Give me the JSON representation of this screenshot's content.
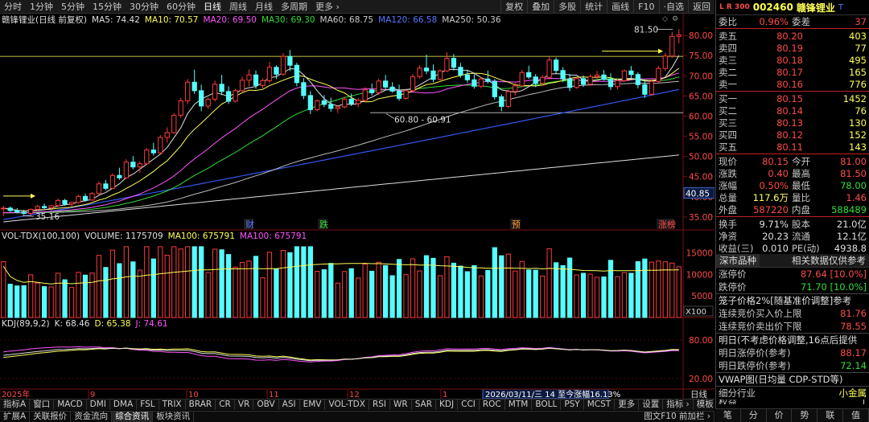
{
  "toolbar": {
    "periods": [
      "分时",
      "1分钟",
      "5分钟",
      "15分钟",
      "30分钟",
      "60分钟",
      "日线",
      "周线",
      "月线",
      "多周期",
      "更多 ›"
    ],
    "active": "日线",
    "right": [
      "复权",
      "叠加",
      "多股",
      "统计",
      "画线",
      "F10",
      "·自选",
      "返回"
    ]
  },
  "legend": {
    "title": "赣锋锂业(日线 前复权)",
    "ma": [
      {
        "label": "MA5: 74.42",
        "color": "#e0e0e0"
      },
      {
        "label": "MA10: 70.57",
        "color": "#ffff55"
      },
      {
        "label": "MA20: 69.50",
        "color": "#ff55ff"
      },
      {
        "label": "MA30: 69.30",
        "color": "#33dd33"
      },
      {
        "label": "MA60: 68.75",
        "color": "#cccccc"
      },
      {
        "label": "MA120: 66.58",
        "color": "#5577ff"
      },
      {
        "label": "MA250: 50.36",
        "color": "#cccccc"
      }
    ]
  },
  "vol_legend": {
    "title": "VOL-TDX(100,100)",
    "items": [
      {
        "label": "VOLUME: 1175709",
        "color": "#e0e0e0"
      },
      {
        "label": "MA100: 675791",
        "color": "#ffff55"
      },
      {
        "label": "MA100: 675791",
        "color": "#ff55ff"
      }
    ]
  },
  "kdj_legend": {
    "title": "KDJ(89,9,2)",
    "items": [
      {
        "label": "K: 68.46",
        "color": "#e0e0e0"
      },
      {
        "label": "D: 65.38",
        "color": "#ffff55"
      },
      {
        "label": "J: 74.61",
        "color": "#ff55ff"
      }
    ]
  },
  "price_axis": [
    "80.00",
    "75.00",
    "70.00",
    "65.00",
    "60.00",
    "55.00",
    "50.00",
    "45.00",
    "40.00",
    "35.00"
  ],
  "vol_axis": [
    "15000",
    "10000",
    "5000"
  ],
  "vol_unit": "X100",
  "kdj_axis": [
    "80.00",
    "20.00"
  ],
  "current_price_tag": "40.85",
  "annotations": {
    "high": "81.50",
    "range": "60.80 - 60.91",
    "low": "35.16"
  },
  "event_labels": [
    {
      "text": "财",
      "color": "#5577ff"
    },
    {
      "text": "跌",
      "color": "#33dd33"
    },
    {
      "text": "预",
      "color": "#ff9933"
    },
    {
      "text": "涨榜",
      "color": "#ff4a4a"
    }
  ],
  "time_axis": [
    "2025年",
    "9",
    "10",
    "11",
    "12",
    "1",
    "2026/03/11/三 14 至今涨幅16.13%"
  ],
  "time_axis_right": "日线",
  "indicator_tabs": [
    "指标A",
    "窗口",
    "MACD",
    "DMI",
    "DMA",
    "FSL",
    "TRIX",
    "BRAR",
    "CR",
    "VR",
    "OBV",
    "ASI",
    "EMV",
    "VOL-TDX",
    "RSI",
    "WR",
    "SAR",
    "KDJ",
    "CCI",
    "ROC",
    "MTM",
    "BOLL",
    "PSY",
    "MCST",
    "更多",
    "设置"
  ],
  "indicator_tabs_right": [
    "指标 ›",
    "模板",
    "板"
  ],
  "status_tabs": [
    "扩展A",
    "关联报价",
    "资金流向",
    "综合资讯",
    "板块资讯"
  ],
  "status_active": "综合资讯",
  "status_right": "图文F10 前加栏 ›",
  "quote": {
    "badge": "L R 300",
    "code": "002460",
    "name": "赣锋锂业",
    "suffix": "T",
    "webi": {
      "k1": "委比",
      "v1": "0.96%",
      "k2": "委差",
      "v2": "37"
    },
    "asks": [
      {
        "k": "卖五",
        "p": "80.20",
        "q": "403"
      },
      {
        "k": "卖四",
        "p": "80.19",
        "q": "77"
      },
      {
        "k": "卖三",
        "p": "80.18",
        "q": "495"
      },
      {
        "k": "卖二",
        "p": "80.17",
        "q": "165"
      },
      {
        "k": "卖一",
        "p": "80.16",
        "q": "776"
      }
    ],
    "bids": [
      {
        "k": "买一",
        "p": "80.15",
        "q": "1452"
      },
      {
        "k": "买二",
        "p": "80.14",
        "q": "76"
      },
      {
        "k": "买三",
        "p": "80.13",
        "q": "130"
      },
      {
        "k": "买四",
        "p": "80.12",
        "q": "152"
      },
      {
        "k": "买五",
        "p": "80.11",
        "q": "143"
      }
    ],
    "stats1": [
      {
        "k1": "现价",
        "v1": "80.15",
        "c1": "#ff4a4a",
        "k2": "今开",
        "v2": "81.00",
        "c2": "#ff4a4a"
      },
      {
        "k1": "涨跌",
        "v1": "0.40",
        "c1": "#ff4a4a",
        "k2": "最高",
        "v2": "81.50",
        "c2": "#ff4a4a"
      },
      {
        "k1": "涨幅",
        "v1": "0.50%",
        "c1": "#ff4a4a",
        "k2": "最低",
        "v2": "78.00",
        "c2": "#33dd33"
      },
      {
        "k1": "总量",
        "v1": "117.6万",
        "c1": "#ffff55",
        "k2": "量比",
        "v2": "1.46",
        "c2": "#ff4a4a"
      },
      {
        "k1": "外盘",
        "v1": "587220",
        "c1": "#ff4a4a",
        "k2": "内盘",
        "v2": "588489",
        "c2": "#33dd33"
      }
    ],
    "stats2": [
      {
        "k1": "换手",
        "v1": "9.71%",
        "c1": "#e0e0e0",
        "k2": "股本",
        "v2": "21.0亿",
        "c2": "#e0e0e0"
      },
      {
        "k1": "净资",
        "v1": "20.23",
        "c1": "#e0e0e0",
        "k2": "流通",
        "v2": "12.1亿",
        "c2": "#e0e0e0"
      },
      {
        "k1": "收益(三)",
        "v1": "0.010",
        "c1": "#e0e0e0",
        "k2": "PE(动)",
        "v2": "4938.8",
        "c2": "#e0e0e0"
      }
    ],
    "tab_row": [
      "深市品种",
      "相关数据仅供参考"
    ],
    "limits": [
      {
        "k": "涨停价",
        "v": "87.64 [10.0%]",
        "c": "#ff4a4a"
      },
      {
        "k": "跌停价",
        "v": "71.70 [10.0%]",
        "c": "#33dd33"
      }
    ],
    "cage_title": "笼子价格2%[随基准价调整]参考",
    "cage": [
      {
        "k": "连续竞价买入价上限",
        "v": "81.76",
        "c": "#ff4a4a"
      },
      {
        "k": "连续竞价卖出价下限",
        "v": "78.55",
        "c": "#ff4a4a"
      }
    ],
    "tomorrow_title": "明日(不考虑价格调整,16点后提供",
    "tomorrow": [
      {
        "k": "明日涨停价(参考)",
        "v": "88.17",
        "c": "#ff4a4a"
      },
      {
        "k": "明日跌停价(参考)",
        "v": "72.14",
        "c": "#33dd33"
      }
    ],
    "vwap": "VWAP图(日均量 CDP-STD等)",
    "industry": {
      "k": "细分行业",
      "v": "小金属"
    },
    "partial": {
      "k": "权益",
      "v": "1"
    }
  },
  "right_bottom": [
    "笔",
    "分",
    "价",
    "势",
    "联",
    "值"
  ],
  "chart_data": {
    "type": "line",
    "title": "赣锋锂业(日线 前复权)",
    "price": {
      "ylim": [
        32,
        83
      ],
      "ma_last": {
        "MA5": 74.42,
        "MA10": 70.57,
        "MA20": 69.5,
        "MA30": 69.3,
        "MA60": 68.75,
        "MA120": 66.58,
        "MA250": 50.36
      },
      "candles": [
        [
          37,
          37.8,
          35.2,
          37.2
        ],
        [
          37.2,
          37.6,
          36.2,
          36.6
        ],
        [
          36.6,
          37.2,
          35.9,
          36.2
        ],
        [
          36.2,
          36.8,
          35.5,
          35.9
        ],
        [
          35.9,
          37.1,
          35.2,
          36.9
        ],
        [
          36.9,
          38,
          36.5,
          37.6
        ],
        [
          37.6,
          38.3,
          37,
          37.3
        ],
        [
          37.3,
          37.9,
          36.6,
          37.8
        ],
        [
          37.8,
          39.6,
          37.5,
          39.1
        ],
        [
          39.1,
          39.5,
          37.8,
          38.2
        ],
        [
          38.2,
          38.8,
          37.5,
          38.6
        ],
        [
          38.6,
          40.5,
          38.3,
          40.1
        ],
        [
          40.1,
          40.8,
          38.8,
          39.2
        ],
        [
          39.2,
          41.2,
          39,
          40.8
        ],
        [
          40.8,
          43.8,
          40.4,
          43.2
        ],
        [
          43.2,
          44.2,
          41.6,
          42.1
        ],
        [
          42.1,
          45.8,
          41.9,
          45.3
        ],
        [
          45.3,
          47.2,
          44.2,
          44.7
        ],
        [
          44.7,
          49.3,
          44.4,
          48.6
        ],
        [
          48.6,
          50.1,
          46.8,
          47.4
        ],
        [
          47.4,
          48.8,
          46,
          48.2
        ],
        [
          48.2,
          52.1,
          47.9,
          51.6
        ],
        [
          51.6,
          53.4,
          50.2,
          50.9
        ],
        [
          50.9,
          55.3,
          50.6,
          54.7
        ],
        [
          54.7,
          57.2,
          53.4,
          55.9
        ],
        [
          55.9,
          60.8,
          55.6,
          60.2
        ],
        [
          60.2,
          64.5,
          59.6,
          63.8
        ],
        [
          63.8,
          69.2,
          62.9,
          68.4
        ],
        [
          68.4,
          71.5,
          65.5,
          66.3
        ],
        [
          66.3,
          67.8,
          61.2,
          62.5
        ],
        [
          62.5,
          64.6,
          61.8,
          64.2
        ],
        [
          64.2,
          68.8,
          63.6,
          67.9
        ],
        [
          67.9,
          70.2,
          65.2,
          66.1
        ],
        [
          66.1,
          67.4,
          63,
          63.7
        ],
        [
          63.7,
          66.8,
          63.4,
          66.3
        ],
        [
          66.3,
          69.8,
          65.8,
          68.9
        ],
        [
          68.9,
          71.6,
          67.4,
          70.2
        ],
        [
          70.2,
          71.3,
          66.8,
          67.6
        ],
        [
          67.6,
          69.4,
          66.9,
          68.8
        ],
        [
          68.8,
          73.4,
          68.2,
          72.1
        ],
        [
          72.1,
          72.6,
          69.2,
          70.4
        ],
        [
          70.4,
          75.6,
          70,
          74.8
        ],
        [
          74.8,
          76.4,
          71.2,
          72.6
        ],
        [
          72.6,
          73.2,
          67.4,
          68.3
        ],
        [
          68.3,
          69.4,
          64.2,
          65.1
        ],
        [
          65.1,
          66.2,
          60.5,
          61.6
        ],
        [
          61.6,
          64.1,
          61.2,
          63.8
        ],
        [
          63.8,
          65.2,
          62.2,
          62.9
        ],
        [
          62.9,
          64.6,
          61.1,
          61.9
        ],
        [
          61.9,
          62.6,
          60.8,
          62.3
        ],
        [
          62.3,
          64.8,
          61.9,
          64.2
        ],
        [
          64.2,
          65.6,
          62.5,
          63.1
        ],
        [
          63.1,
          64.5,
          62.2,
          63.9
        ],
        [
          63.9,
          67.2,
          63.5,
          66.5
        ],
        [
          66.5,
          68.1,
          65.1,
          65.8
        ],
        [
          65.8,
          69.3,
          65.3,
          68.7
        ],
        [
          68.7,
          70.2,
          66.6,
          67.2
        ],
        [
          67.2,
          68.4,
          65.8,
          66.2
        ],
        [
          66.2,
          67.8,
          63.8,
          64.4
        ],
        [
          64.4,
          66.8,
          64.1,
          66.3
        ],
        [
          66.3,
          70.4,
          66,
          69.8
        ],
        [
          69.8,
          72.6,
          69.3,
          71.9
        ],
        [
          71.9,
          75.2,
          70.4,
          71.2
        ],
        [
          71.2,
          72.8,
          68.4,
          69.1
        ],
        [
          69.1,
          71.6,
          68.8,
          71.2
        ],
        [
          71.2,
          75.8,
          70.9,
          74.3
        ],
        [
          74.3,
          75.4,
          71.3,
          72.1
        ],
        [
          72.1,
          73.2,
          69.5,
          70.2
        ],
        [
          70.2,
          71.4,
          68.3,
          69
        ],
        [
          69,
          70.4,
          66.8,
          67.4
        ],
        [
          67.4,
          69.6,
          66.9,
          69.2
        ],
        [
          69.2,
          71.3,
          68.1,
          68.6
        ],
        [
          68.6,
          69.2,
          64.1,
          64.8
        ],
        [
          64.8,
          65.4,
          61.2,
          62.4
        ],
        [
          62.4,
          66.6,
          62,
          66.1
        ],
        [
          66.1,
          68.2,
          65.1,
          67.5
        ],
        [
          67.5,
          71.4,
          67.2,
          70.8
        ],
        [
          70.8,
          72.5,
          69.2,
          69.7
        ],
        [
          69.7,
          70.4,
          67.2,
          68.1
        ],
        [
          68.1,
          70.2,
          67.5,
          69.6
        ],
        [
          69.6,
          74.8,
          69.1,
          73.9
        ],
        [
          73.9,
          74.5,
          70.4,
          71.3
        ],
        [
          71.3,
          72.1,
          68.4,
          69.2
        ],
        [
          69.2,
          70.5,
          66.2,
          67.1
        ],
        [
          67.1,
          69.6,
          66.8,
          69.3
        ],
        [
          69.3,
          70.1,
          67.2,
          67.9
        ],
        [
          67.9,
          70.4,
          67.5,
          69.8
        ],
        [
          69.8,
          71.2,
          68.6,
          70.2
        ],
        [
          70.2,
          71.4,
          68.8,
          69.1
        ],
        [
          69.1,
          70.6,
          66.5,
          67.3
        ],
        [
          67.3,
          69.2,
          66.6,
          68.8
        ],
        [
          68.8,
          71.6,
          68.5,
          71.2
        ],
        [
          71.2,
          72.4,
          69.4,
          70.3
        ],
        [
          70.3,
          70.9,
          66.9,
          67.8
        ],
        [
          67.8,
          68.6,
          64.5,
          65.4
        ],
        [
          65.4,
          69.1,
          65.1,
          68.6
        ],
        [
          68.6,
          72.4,
          68.1,
          71.8
        ],
        [
          71.8,
          75.6,
          71.2,
          74.9
        ],
        [
          74.9,
          80.9,
          74.4,
          79.75
        ],
        [
          79.75,
          81.5,
          78,
          80.15
        ]
      ]
    },
    "volume": {
      "ylim": [
        0,
        17500
      ],
      "unit": "X100",
      "ma100_last": 675791
    },
    "kdj": {
      "params": "89,9,2",
      "K": 68.46,
      "D": 65.38,
      "J": 74.61,
      "ylim": [
        0,
        100
      ]
    }
  }
}
